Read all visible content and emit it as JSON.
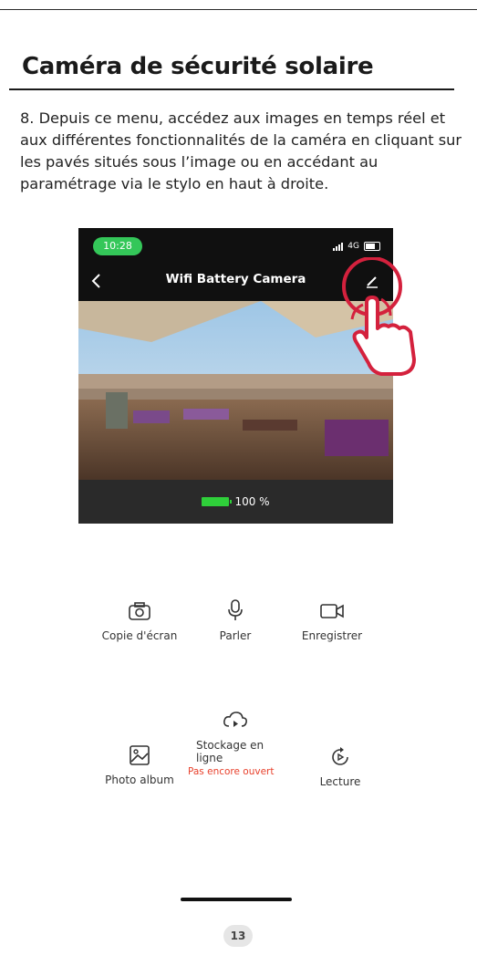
{
  "document": {
    "title": "Caméra de sécurité solaire",
    "instruction": "8. Depuis ce menu, accédez aux images en temps réel et aux différentes fonctionnalités de la caméra en cliquant sur les pavés situés sous l’image ou en accédant au paramétrage via le stylo en haut à droite.",
    "page_number": "13"
  },
  "phone": {
    "status": {
      "time": "10:28",
      "network": "4G"
    },
    "header": {
      "title": "Wifi Battery Camera"
    },
    "battery": {
      "text": "100 %",
      "level_percent": 100
    },
    "controls": {
      "row1": [
        {
          "label": "Copie d'écran",
          "icon": "camera-icon"
        },
        {
          "label": "Parler",
          "icon": "microphone-icon"
        },
        {
          "label": "Enregistrer",
          "icon": "video-camera-icon"
        }
      ],
      "row2": [
        {
          "label": "Photo album",
          "icon": "image-icon"
        },
        {
          "label": "Stockage en ligne",
          "sublabel": "Pas encore ouvert",
          "icon": "cloud-icon"
        },
        {
          "label": "Lecture",
          "icon": "playback-icon"
        }
      ]
    }
  },
  "colors": {
    "status_pill": "#34c759",
    "battery": "#2fcf3a",
    "highlight": "#d4213d",
    "warning": "#e8412c"
  }
}
